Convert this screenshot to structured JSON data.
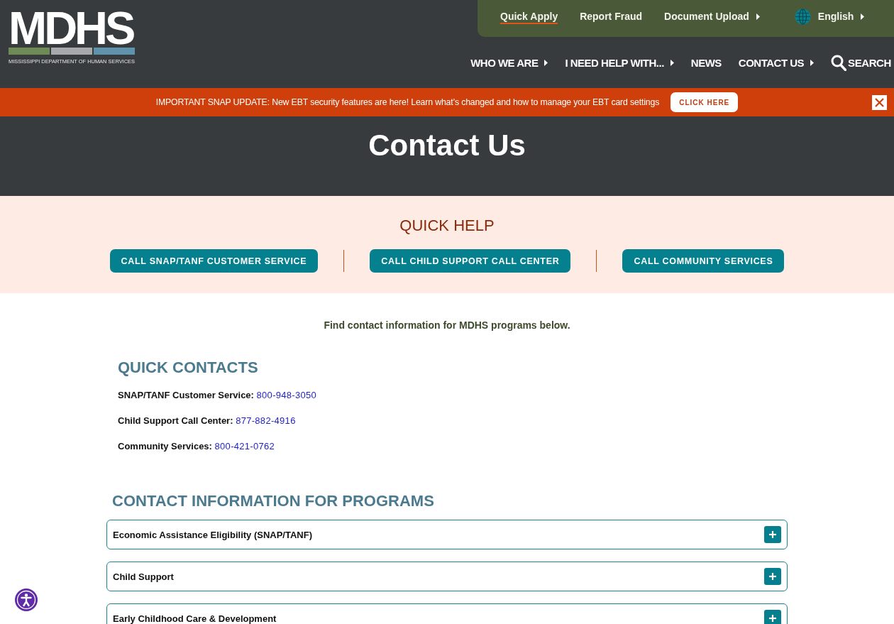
{
  "header": {
    "logo": {
      "wordmark": "MDHS",
      "tagline": "MISSISSIPPI DEPARTMENT OF HUMAN SERVICES"
    },
    "utility_links": [
      {
        "label": "Quick Apply",
        "underlined": true,
        "has_submenu": false
      },
      {
        "label": "Report Fraud",
        "underlined": false,
        "has_submenu": false
      },
      {
        "label": "Document Upload",
        "underlined": false,
        "has_submenu": true
      }
    ],
    "language": {
      "label": "English",
      "has_submenu": true
    },
    "main_nav": [
      {
        "label": "WHO WE ARE",
        "has_submenu": true
      },
      {
        "label": "I NEED HELP WITH...",
        "has_submenu": true
      },
      {
        "label": "NEWS",
        "has_submenu": false
      },
      {
        "label": "CONTACT US",
        "has_submenu": true
      }
    ],
    "search": {
      "label": "SEARCH"
    }
  },
  "alert": {
    "text": "IMPORTANT SNAP UPDATE: New EBT security features are here! Learn what’s changed and how to manage your EBT card settings",
    "button": "CLICK HERE"
  },
  "hero": {
    "title": "Contact Us"
  },
  "quick_help": {
    "title": "QUICK HELP",
    "buttons": [
      "CALL SNAP/TANF CUSTOMER SERVICE",
      "CALL CHILD SUPPORT CALL CENTER",
      "CALL COMMUNITY SERVICES"
    ]
  },
  "intro": "Find contact information for MDHS programs below.",
  "quick_contacts": {
    "title": "QUICK CONTACTS",
    "items": [
      {
        "label": "SNAP/TANF Customer Service:",
        "phone": "800-948-3050"
      },
      {
        "label": "Child Support Call Center:",
        "phone": "877-882-4916"
      },
      {
        "label": "Community Services:",
        "phone": "800-421-0762"
      }
    ]
  },
  "programs": {
    "title": "CONTACT INFORMATION FOR PROGRAMS",
    "items": [
      {
        "title": "Economic Assistance Eligibility (SNAP/TANF)",
        "expanded": false
      },
      {
        "title": "Child Support",
        "expanded": false
      },
      {
        "title": "Early Childhood Care & Development",
        "expanded": false
      }
    ]
  }
}
